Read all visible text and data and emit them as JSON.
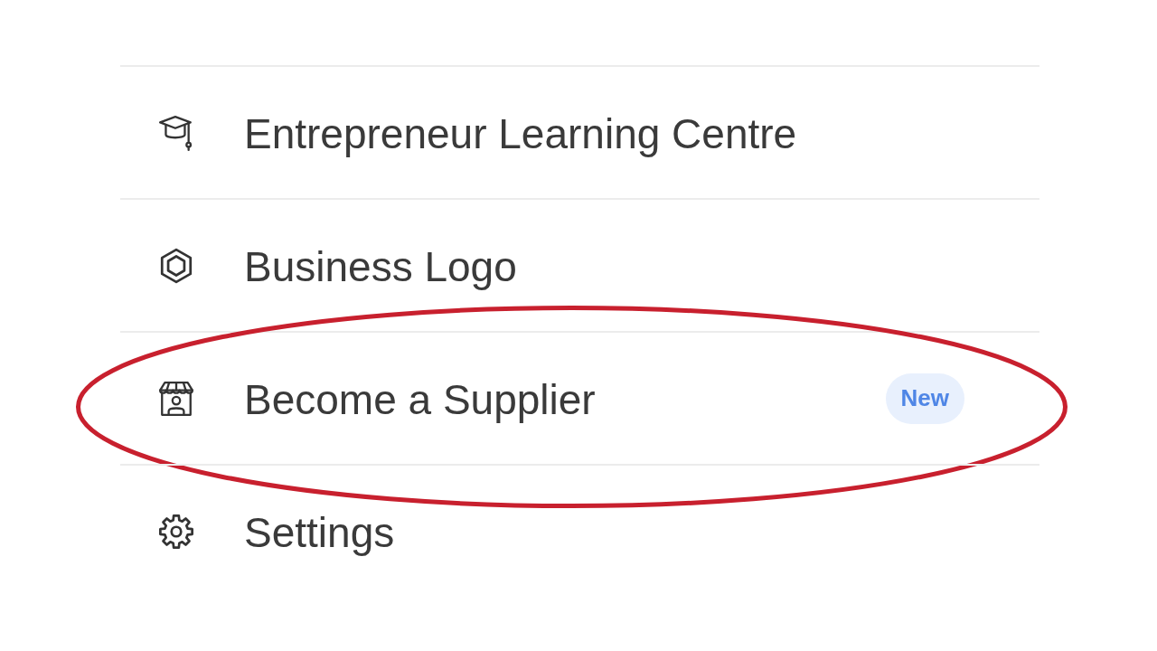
{
  "menu": {
    "items": [
      {
        "kind": "learning",
        "label": "Entrepreneur Learning Centre",
        "highlighted": false
      },
      {
        "kind": "logo",
        "label": "Business Logo",
        "highlighted": false
      },
      {
        "kind": "supplier",
        "label": "Become a Supplier",
        "badge": "New",
        "highlighted": true
      },
      {
        "kind": "settings",
        "label": "Settings",
        "highlighted": false
      }
    ]
  }
}
